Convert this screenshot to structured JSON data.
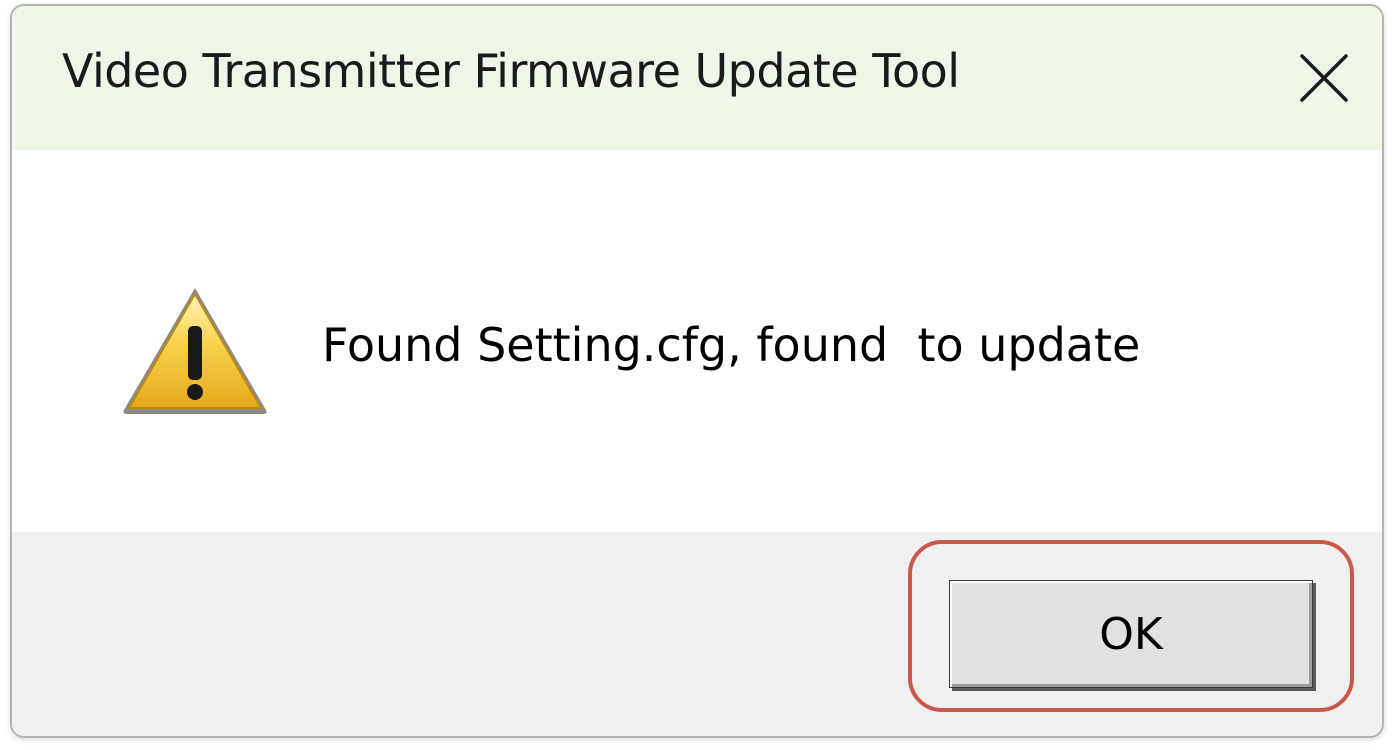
{
  "dialog": {
    "title": "Video Transmitter Firmware Update Tool",
    "close_icon": "close-icon",
    "message": "Found Setting.cfg, found  to update",
    "icon": "warning-icon",
    "ok_label": "OK"
  },
  "colors": {
    "titlebar_bg": "#eef6e8",
    "footer_bg": "#f0f0f0",
    "highlight": "#c9574a",
    "warning_yellow": "#f2c23a"
  }
}
